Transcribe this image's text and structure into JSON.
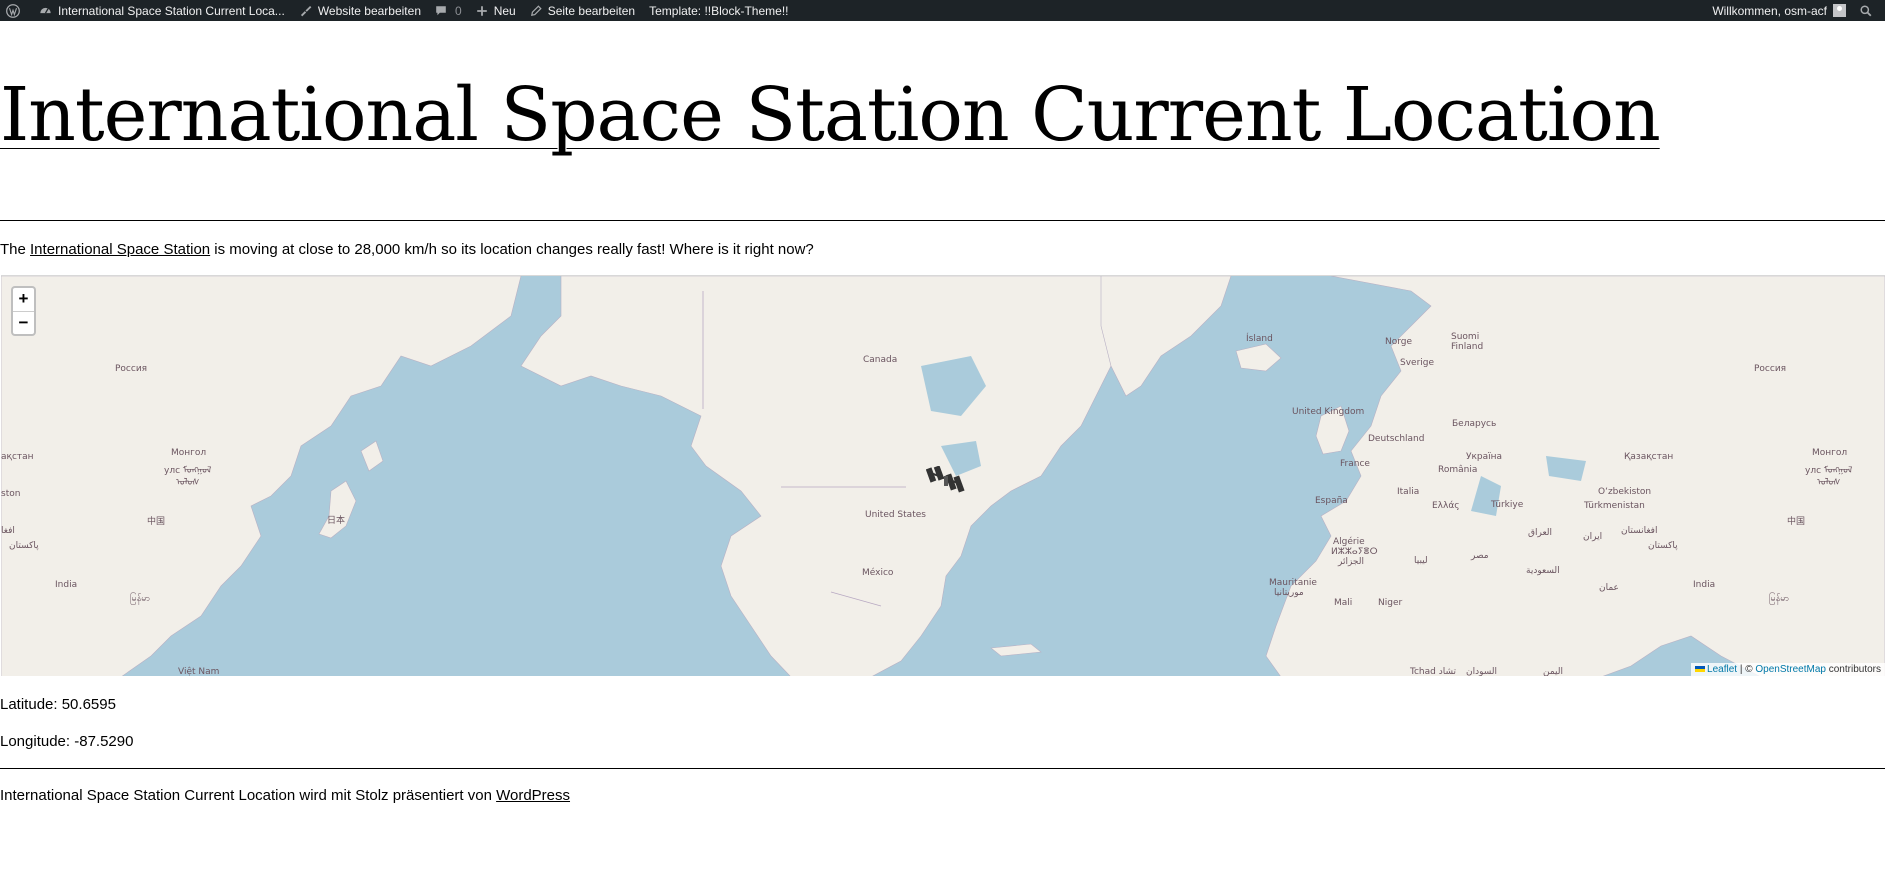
{
  "adminbar": {
    "site_name": "International Space Station Current Loca...",
    "customize": "Website bearbeiten",
    "comments_count": "0",
    "new": "Neu",
    "edit_page": "Seite bearbeiten",
    "template": "Template: !!Block-Theme!!",
    "greeting": "Willkommen, osm-acf"
  },
  "page": {
    "title": "International Space Station Current Location",
    "intro_before": "The ",
    "intro_link": "International Space Station",
    "intro_after": " is moving at close to 28,000 km/h so its location changes really fast! Where is it right now?"
  },
  "map": {
    "zoom_in": "+",
    "zoom_out": "−",
    "attribution_leaflet": "Leaflet",
    "attribution_sep": " | © ",
    "attribution_osm": "OpenStreetMap",
    "attribution_tail": " contributors",
    "labels": {
      "russia_w": "Россия",
      "russia_e": "Россия",
      "mongol_w": "Монгол",
      "mongol_w2": "улс ᠮᠣᠩᠭᠣᠯ",
      "mongol_w3": "ᠤᠯᠤᠰ",
      "mongol_e": "Монгол",
      "mongol_e2": "улс ᠮᠣᠩᠭᠣᠯ",
      "mongol_e3": "ᠤᠯᠤᠰ",
      "kz_w": "ақстан",
      "kz_e": "Қазақстан",
      "china_w": "中国",
      "china_e": "中国",
      "japan": "日本",
      "pak_w": "پاکستان",
      "pak_e": "پاکستان",
      "afg_w": "افغا",
      "afg_e": "افغانستان",
      "ston": "ston",
      "india_w": "India",
      "india_e": "India",
      "myanmar_w": "မြန်မာ",
      "myanmar_e": "မြန်မာ",
      "vietnam": "Việt Nam",
      "canada": "Canada",
      "us": "United States",
      "mexico": "México",
      "island": "Ísland",
      "norge": "Norge",
      "sverige": "Sverige",
      "suomi": "Suomi",
      "finland": "Finland",
      "uk": "United Kingdom",
      "deutschland": "Deutschland",
      "belarus": "Беларусь",
      "france": "France",
      "ukraina": "Україна",
      "romania": "România",
      "italia": "Italia",
      "ellas": "Ελλάς",
      "espana": "España",
      "turkiye": "Türkiye",
      "turkmenistan": "Türkmenistan",
      "uzbekiston": "Oʻzbekiston",
      "iraq": "العراق",
      "iran": "ایران",
      "algerie": "Algérie",
      "algerie2": "ⵍⵣⵣⴰⵢⴻⵔ",
      "algerie3": "الجزائر",
      "libya": "ليبيا",
      "misr": "مصر",
      "saudi": "السعودية",
      "oman": "عمان",
      "mauritanie": "Mauritanie",
      "mauritanie2": "موريتانيا",
      "mali": "Mali",
      "niger": "Niger",
      "tchad": "Tchad تشاد",
      "sudan": "السودان",
      "yemen": "اليمن"
    }
  },
  "coords": {
    "latitude": "Latitude: 50.6595",
    "longitude": "Longitude: -87.5290"
  },
  "footer": {
    "text": "International Space Station Current Location wird mit Stolz präsentiert von ",
    "link": "WordPress"
  }
}
